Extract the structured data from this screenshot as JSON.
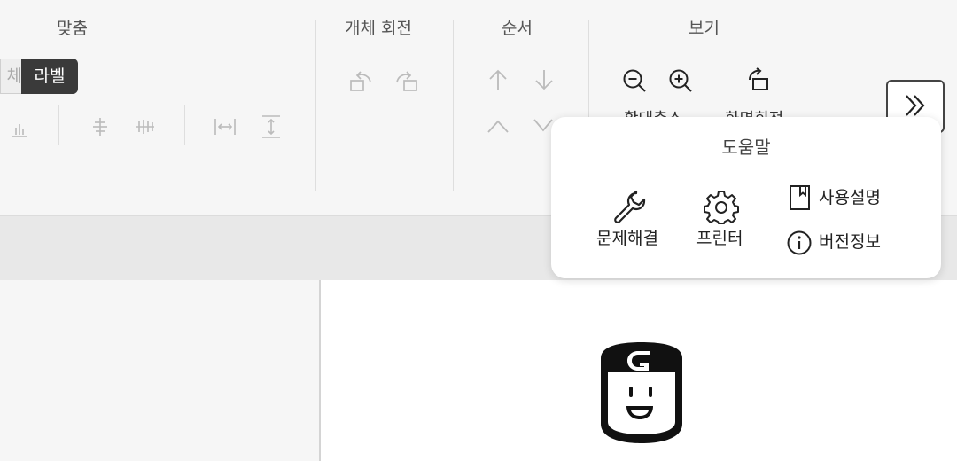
{
  "toolbar": {
    "groups": {
      "align": "맞춤",
      "rotate": "개체 회전",
      "order": "순서",
      "view": "보기"
    },
    "label_toggle": {
      "off_label": "체",
      "on_label": "라벨"
    },
    "view_items": {
      "zoom_out_cut": "확대축소",
      "rotate_view_cut": "화면회전"
    }
  },
  "help_popup": {
    "title": "도움말",
    "troubleshoot": "문제해결",
    "printer": "프린터",
    "manual": "사용설명",
    "version": "버전정보"
  }
}
